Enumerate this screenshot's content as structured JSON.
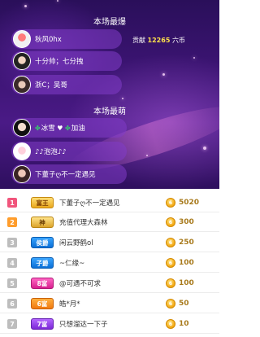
{
  "popular_section": {
    "title": "本场最爆",
    "users": [
      {
        "name": "秋风0hx",
        "avatar": "av-a"
      },
      {
        "name": "十分帅；七分拽",
        "avatar": "av-b"
      },
      {
        "name": "浙C；吴哥",
        "avatar": "av-c"
      }
    ],
    "contribution": {
      "label": "贡献",
      "value": "12265",
      "unit": "六币"
    }
  },
  "cute_section": {
    "title": "本场最萌",
    "users": [
      {
        "name": "冰雪",
        "suffix": "加油",
        "avatar": "av-d"
      },
      {
        "name": "♪♪泡泡♪♪",
        "avatar": "av-e"
      },
      {
        "name": "下董子ღ不一定遇见",
        "avatar": "av-f"
      }
    ]
  },
  "ranking": {
    "rows": [
      {
        "rank": "1",
        "badge": "富王",
        "name": "下董子ღ不一定遇见",
        "score": "5020",
        "rank_color": "#f1557c",
        "badge_style": "gold"
      },
      {
        "rank": "2",
        "badge": "神",
        "name": "充值代理大森林",
        "score": "300",
        "rank_color": "#ff9d2c",
        "badge_style": "gold2"
      },
      {
        "rank": "3",
        "badge": "侯爵",
        "name": "闲云野鹤ol",
        "score": "250",
        "rank_color": "#bdbdbd",
        "badge_style": "blue"
      },
      {
        "rank": "4",
        "badge": "子爵",
        "name": "~仁缘~",
        "score": "100",
        "rank_color": "#bdbdbd",
        "badge_style": "blue"
      },
      {
        "rank": "5",
        "badge": "8富",
        "name": "@可遇不可求",
        "score": "100",
        "rank_color": "#bdbdbd",
        "badge_style": "pink"
      },
      {
        "rank": "6",
        "badge": "6富",
        "name": "皓*月*",
        "score": "50",
        "rank_color": "#bdbdbd",
        "badge_style": "orange"
      },
      {
        "rank": "7",
        "badge": "7富",
        "name": "只想溜达一下子",
        "score": "10",
        "rank_color": "#bdbdbd",
        "badge_style": "purple"
      }
    ],
    "coin_symbol": "6"
  }
}
